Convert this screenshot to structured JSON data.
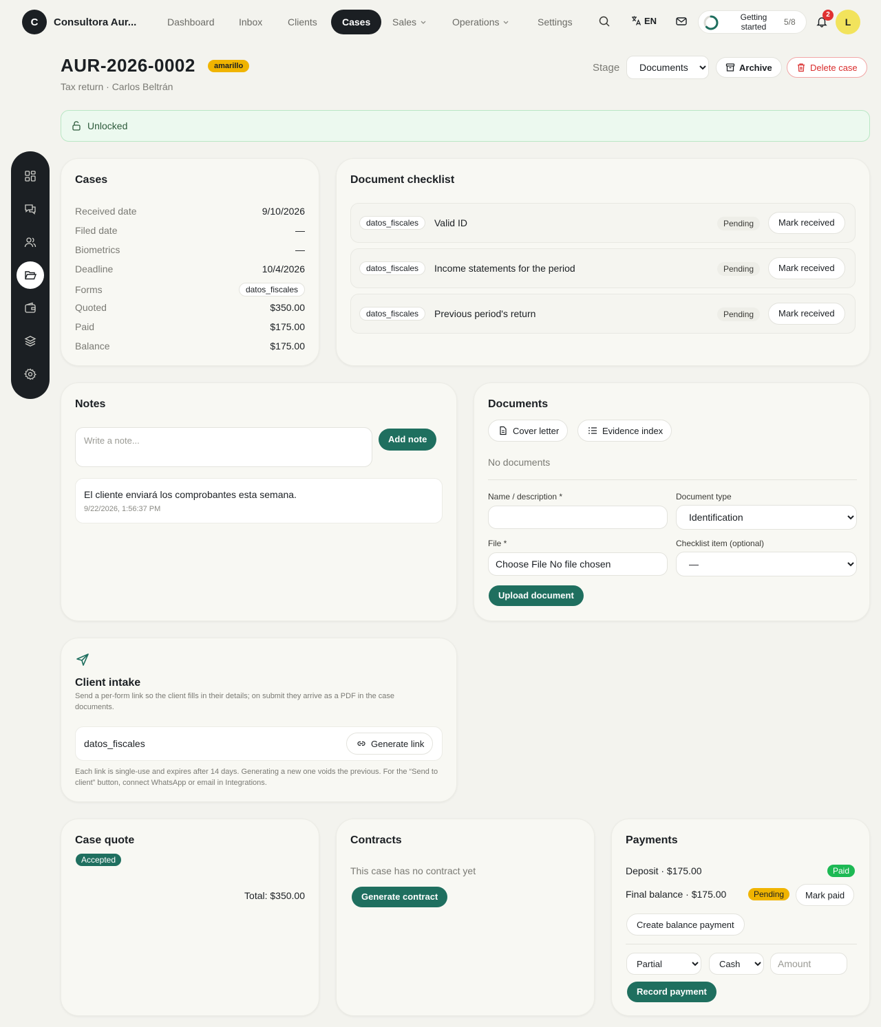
{
  "app": {
    "brand_initial": "C",
    "brand_name": "Consultora Aur..."
  },
  "nav": {
    "dashboard": "Dashboard",
    "inbox": "Inbox",
    "clients": "Clients",
    "cases": "Cases",
    "sales": "Sales",
    "operations": "Operations",
    "settings": "Settings",
    "language": "EN",
    "getting_started": "Getting started",
    "getting_started_count": "5/8",
    "getting_started_progress": 0.625,
    "notifications_count": "2",
    "avatar_initial": "L"
  },
  "sidebar_icons": [
    "grid-icon",
    "chat-icon",
    "users-icon",
    "folder-icon",
    "wallet-icon",
    "layers-icon",
    "gear-icon"
  ],
  "case": {
    "id": "AUR-2026-0002",
    "badge": "amarillo",
    "subtitle": "Tax return · Carlos Beltrán",
    "stage_label": "Stage",
    "stage_value": "Documents",
    "archive_label": "Archive",
    "delete_label": "Delete case",
    "lock_status": "Unlocked"
  },
  "cases_card": {
    "title": "Cases",
    "rows": [
      {
        "k": "Received date",
        "v": "9/10/2026"
      },
      {
        "k": "Filed date",
        "v": "—"
      },
      {
        "k": "Biometrics",
        "v": "—"
      },
      {
        "k": "Deadline",
        "v": "10/4/2026"
      },
      {
        "k": "Forms",
        "v": "datos_fiscales"
      },
      {
        "k": "Quoted",
        "v": "$350.00"
      },
      {
        "k": "Paid",
        "v": "$175.00"
      },
      {
        "k": "Balance",
        "v": "$175.00"
      }
    ]
  },
  "checklist": {
    "title": "Document checklist",
    "items": [
      {
        "form": "datos_fiscales",
        "label": "Valid ID",
        "status": "Pending",
        "action": "Mark received"
      },
      {
        "form": "datos_fiscales",
        "label": "Income statements for the period",
        "status": "Pending",
        "action": "Mark received"
      },
      {
        "form": "datos_fiscales",
        "label": "Previous period's return",
        "status": "Pending",
        "action": "Mark received"
      }
    ]
  },
  "notes": {
    "title": "Notes",
    "placeholder": "Write a note...",
    "add_label": "Add note",
    "items": [
      {
        "text": "El cliente enviará los comprobantes esta semana.",
        "time": "9/22/2026, 1:56:37 PM"
      }
    ]
  },
  "documents": {
    "title": "Documents",
    "cover_letter": "Cover letter",
    "evidence_index": "Evidence index",
    "empty": "No documents",
    "name_label": "Name / description *",
    "type_label": "Document type",
    "type_value": "Identification",
    "file_label": "File *",
    "file_button": "Choose File",
    "file_status": "No file chosen",
    "checklist_label": "Checklist item (optional)",
    "checklist_value": "—",
    "upload_label": "Upload document"
  },
  "intake": {
    "title": "Client intake",
    "description": "Send a per-form link so the client fills in their details; on submit they arrive as a PDF in the case documents.",
    "form": "datos_fiscales",
    "generate_label": "Generate link",
    "footnote": "Each link is single-use and expires after 14 days. Generating a new one voids the previous. For the “Send to client” button, connect WhatsApp or email in Integrations."
  },
  "quote": {
    "title": "Case quote",
    "status": "Accepted",
    "total": "Total: $350.00"
  },
  "contracts": {
    "title": "Contracts",
    "empty": "This case has no contract yet",
    "generate_label": "Generate contract"
  },
  "payments": {
    "title": "Payments",
    "deposit": "Deposit · $175.00",
    "deposit_status": "Paid",
    "final": "Final balance · $175.00",
    "final_status": "Pending",
    "mark_paid": "Mark paid",
    "create_balance": "Create balance payment",
    "kind_value": "Partial",
    "method_value": "Cash",
    "amount_placeholder": "Amount",
    "record_label": "Record payment"
  }
}
